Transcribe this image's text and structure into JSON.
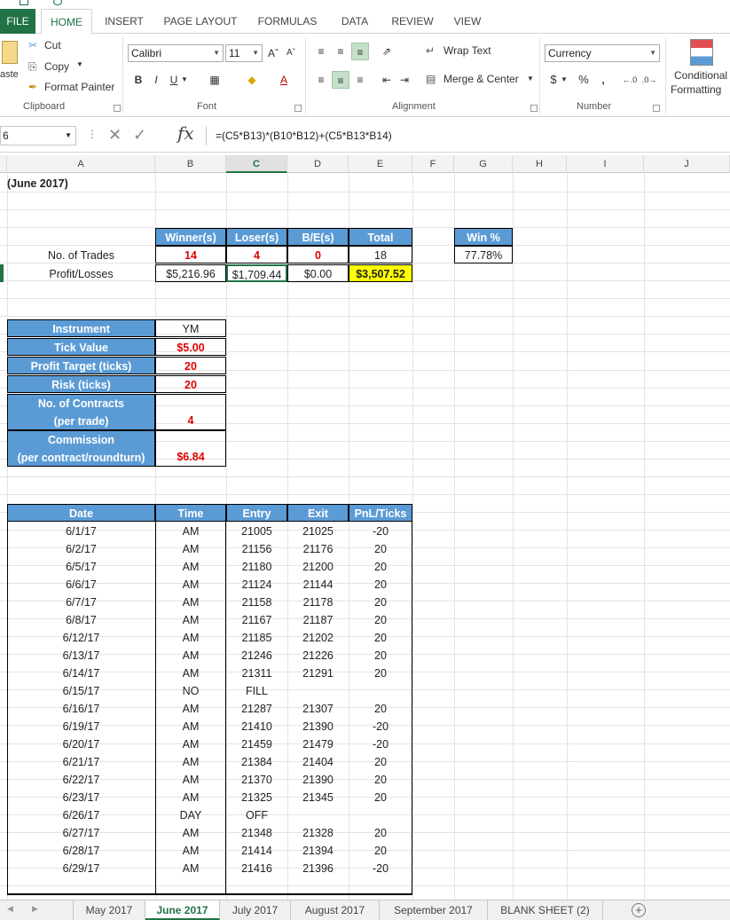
{
  "ribbon": {
    "tabs": [
      "FILE",
      "HOME",
      "INSERT",
      "PAGE LAYOUT",
      "FORMULAS",
      "DATA",
      "REVIEW",
      "VIEW"
    ],
    "clipboard": {
      "paste": "aste",
      "cut": "Cut",
      "copy": "Copy",
      "format_painter": "Format Painter",
      "label": "Clipboard"
    },
    "font": {
      "name": "Calibri",
      "size": "11",
      "bold": "B",
      "italic": "I",
      "underline": "U",
      "label": "Font"
    },
    "alignment": {
      "wrap_text": "Wrap Text",
      "merge_center": "Merge & Center",
      "label": "Alignment"
    },
    "number": {
      "format": "Currency",
      "currency": "$",
      "percent": "%",
      "comma": ",",
      "label": "Number"
    },
    "styles": {
      "conditional_1": "Conditional",
      "conditional_2": "Formatting"
    }
  },
  "formula_bar": {
    "name_box": "6",
    "formula": "=(C5*B13)*(B10*B12)+(C5*B13*B14)"
  },
  "columns": [
    "A",
    "B",
    "C",
    "D",
    "E",
    "F",
    "G",
    "H",
    "I",
    "J"
  ],
  "sheet": {
    "title": "(June 2017)",
    "summary": {
      "headers": [
        "Winner(s)",
        "Loser(s)",
        "B/E(s)",
        "Total"
      ],
      "trades_label": "No. of Trades",
      "trades": [
        "14",
        "4",
        "0",
        "18"
      ],
      "pl_label": "Profit/Losses",
      "pl": [
        "$5,216.96",
        "$1,709.44",
        "$0.00",
        "$3,507.52"
      ],
      "win_header": "Win %",
      "win_value": "77.78%"
    },
    "settings": {
      "instrument_label": "Instrument",
      "instrument": "YM",
      "tick_label": "Tick Value",
      "tick": "$5.00",
      "target_label": "Profit Target (ticks)",
      "target": "20",
      "risk_label": "Risk (ticks)",
      "risk": "20",
      "contracts_label_1": "No. of Contracts",
      "contracts_label_2": "(per trade)",
      "contracts": "4",
      "commission_label_1": "Commission",
      "commission_label_2": "(per contract/roundturn)",
      "commission": "$6.84"
    },
    "trade_headers": [
      "Date",
      "Time",
      "Entry",
      "Exit",
      "PnL/Ticks"
    ],
    "trades": [
      [
        "6/1/17",
        "AM",
        "21005",
        "21025",
        "-20"
      ],
      [
        "6/2/17",
        "AM",
        "21156",
        "21176",
        "20"
      ],
      [
        "6/5/17",
        "AM",
        "21180",
        "21200",
        "20"
      ],
      [
        "6/6/17",
        "AM",
        "21124",
        "21144",
        "20"
      ],
      [
        "6/7/17",
        "AM",
        "21158",
        "21178",
        "20"
      ],
      [
        "6/8/17",
        "AM",
        "21167",
        "21187",
        "20"
      ],
      [
        "6/12/17",
        "AM",
        "21185",
        "21202",
        "20"
      ],
      [
        "6/13/17",
        "AM",
        "21246",
        "21226",
        "20"
      ],
      [
        "6/14/17",
        "AM",
        "21311",
        "21291",
        "20"
      ],
      [
        "6/15/17",
        "NO",
        "FILL",
        "",
        ""
      ],
      [
        "6/16/17",
        "AM",
        "21287",
        "21307",
        "20"
      ],
      [
        "6/19/17",
        "AM",
        "21410",
        "21390",
        "-20"
      ],
      [
        "6/20/17",
        "AM",
        "21459",
        "21479",
        "-20"
      ],
      [
        "6/21/17",
        "AM",
        "21384",
        "21404",
        "20"
      ],
      [
        "6/22/17",
        "AM",
        "21370",
        "21390",
        "20"
      ],
      [
        "6/23/17",
        "AM",
        "21325",
        "21345",
        "20"
      ],
      [
        "6/26/17",
        "DAY",
        "OFF",
        "",
        ""
      ],
      [
        "6/27/17",
        "AM",
        "21348",
        "21328",
        "20"
      ],
      [
        "6/28/17",
        "AM",
        "21414",
        "21394",
        "20"
      ],
      [
        "6/29/17",
        "AM",
        "21416",
        "21396",
        "-20"
      ]
    ]
  },
  "sheet_tabs": [
    "May 2017",
    "June 2017",
    "July 2017",
    "August 2017",
    "September 2017",
    "BLANK SHEET (2)"
  ],
  "colors": {
    "excel_green": "#217346",
    "header_blue": "#5b9bd5",
    "highlight_yellow": "#ffff00",
    "value_red": "#e00000"
  }
}
